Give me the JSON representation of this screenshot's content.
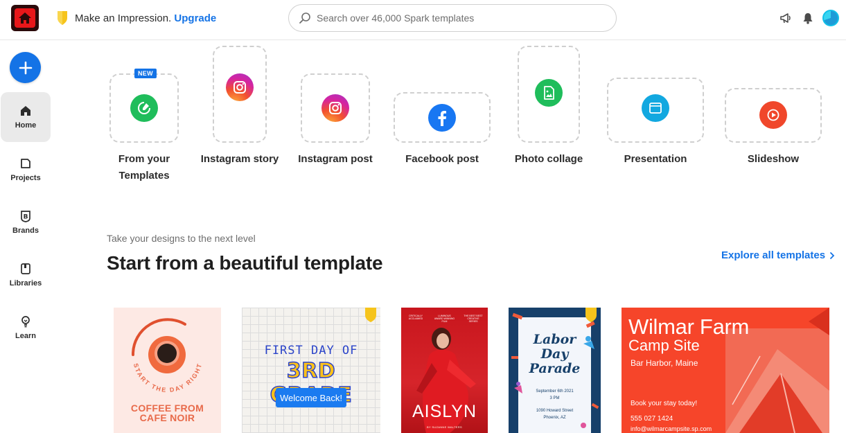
{
  "colors": {
    "accent": "#1473e6",
    "brand_red": "#e8171a",
    "premium_gold": "#f6c41c"
  },
  "topbar": {
    "promo_text": "Make an Impression.",
    "upgrade_label": "Upgrade",
    "search_placeholder": "Search over 46,000 Spark templates",
    "icons": [
      "app-logo-icon",
      "premium-shield-icon",
      "search-icon",
      "megaphone-icon",
      "bell-icon",
      "avatar"
    ]
  },
  "sidebar": {
    "create_icon": "plus-icon",
    "items": [
      {
        "label": "Home",
        "icon": "home-icon",
        "active": true
      },
      {
        "label": "Projects",
        "icon": "projects-icon",
        "active": false
      },
      {
        "label": "Brands",
        "icon": "brands-icon",
        "active": false
      },
      {
        "label": "Libraries",
        "icon": "libraries-icon",
        "active": false
      },
      {
        "label": "Learn",
        "icon": "lightbulb-icon",
        "active": false
      }
    ]
  },
  "quick_actions": {
    "new_badge": "NEW",
    "items": [
      {
        "label_line1": "From your",
        "label_line2": "Templates",
        "icon": "templates-icon",
        "color": "#1fbd5b"
      },
      {
        "label_line1": "Instagram story",
        "icon": "instagram-icon",
        "color": "#d6249f"
      },
      {
        "label_line1": "Instagram post",
        "icon": "instagram-icon",
        "color": "#d6249f"
      },
      {
        "label_line1": "Facebook post",
        "icon": "facebook-icon",
        "color": "#1877f2"
      },
      {
        "label_line1": "Photo collage",
        "icon": "photo-collage-icon",
        "color": "#1fbd5b"
      },
      {
        "label_line1": "Presentation",
        "icon": "presentation-icon",
        "color": "#12a8e0"
      },
      {
        "label_line1": "Slideshow",
        "icon": "slideshow-icon",
        "color": "#f0472b"
      }
    ]
  },
  "section": {
    "subtitle": "Take your designs to the next level",
    "title": "Start from a beautiful template",
    "explore_label": "Explore all templates"
  },
  "templates": {
    "coffee": {
      "ring_text": "START THE DAY RIGHT",
      "line1": "COFFEE FROM",
      "line2": "CAFE NOIR"
    },
    "grade": {
      "line1": "FIRST DAY OF",
      "line2": "3RD GRADE",
      "button": "Welcome Back!"
    },
    "aislyn": {
      "name": "AISLYN",
      "byline": "BY SUZANNE WALTERS",
      "laurel1": "CRITICALLY ACCLAIMED",
      "laurel2": "LUMINOUS AWARD WINNING FILM",
      "laurel3": "THE BEST BEST CREATIVE SERIES"
    },
    "labor": {
      "line1": "Labor",
      "line2": "Day",
      "line3": "Parade",
      "date": "September 6th 2021",
      "time": "3 PM",
      "street": "1090 Howard Street",
      "city": "Phoenix, AZ"
    },
    "wilmar": {
      "title1": "Wilmar Farm",
      "title2": "Camp Site",
      "location": "Bar Harbor, Maine",
      "booking": "Book your stay today!",
      "phone": "555 027 1424",
      "email": "info@wilmarcampsite.sp.com"
    }
  }
}
